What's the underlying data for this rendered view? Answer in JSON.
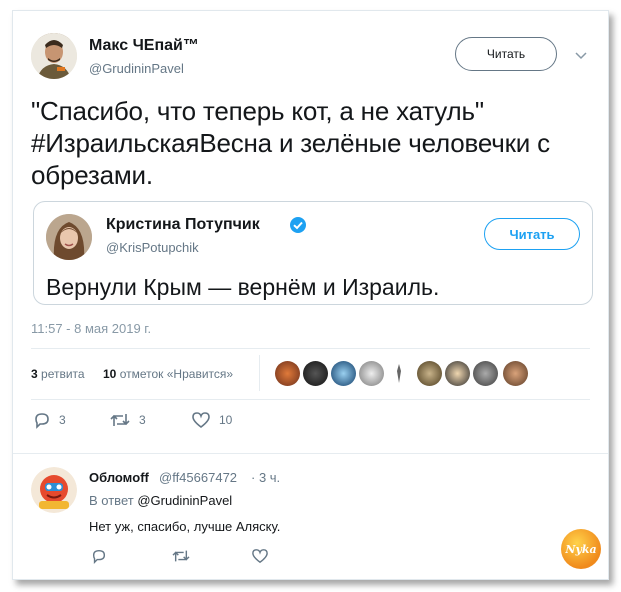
{
  "tweet": {
    "author_name": "Макс ЧЕпай™",
    "author_handle": "@GrudininPavel",
    "follow_label": "Читать",
    "text_line1": "\"Спасибо, что теперь кот, а не хатуль\"",
    "text_line2": "#ИзраильскаяВесна и зелёные человечки с",
    "text_line3": "обрезами.",
    "timestamp": "11:57 - 8 мая 2019 г.",
    "retweets_count": "3",
    "retweets_label": "ретвита",
    "likes_count": "10",
    "likes_label": "отметок «Нравится»",
    "reply_count": "3",
    "retweet_action_count": "3",
    "like_action_count": "10"
  },
  "quoted": {
    "author_name": "Кристина Потупчик",
    "author_handle": "@KrisPotupchik",
    "follow_label": "Читать",
    "text": "Вернули Крым — вернём и Израиль."
  },
  "reply": {
    "author_name": "Обломoff",
    "author_handle": "@ff45667472",
    "time": "· 3 ч.",
    "in_reply_prefix": "В ответ",
    "in_reply_to": "@GrudininPavel",
    "text": "Нет уж, спасибо, лучше Аляску."
  },
  "watermark": {
    "text": "Nyka"
  },
  "colors": {
    "accent": "#1da1f2",
    "verified": "#1da1f2",
    "muted": "#657786"
  }
}
